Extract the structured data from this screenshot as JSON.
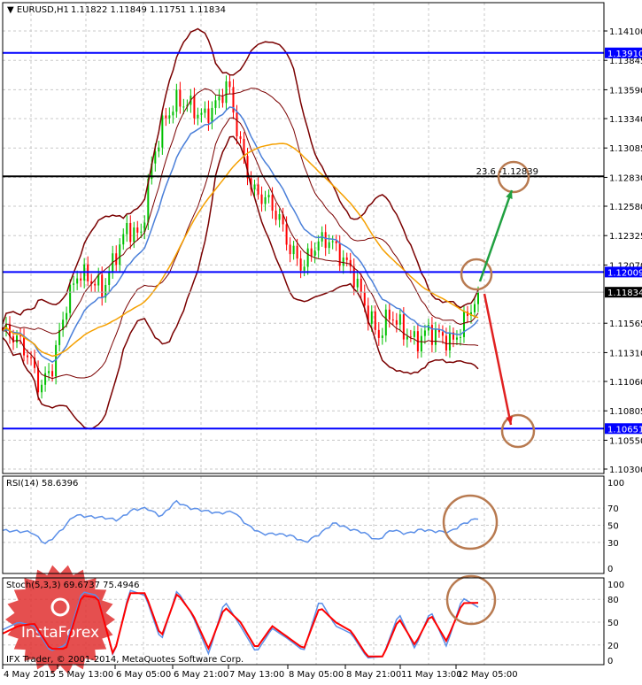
{
  "header": {
    "symbol_label": "EURUSD,H1",
    "ohlc": "1.11822 1.11849 1.11751 1.11834"
  },
  "colors": {
    "up": "#00c000",
    "down": "#ff0000",
    "ma_fast": "#4a7fd9",
    "ma_slow": "#f5a000",
    "bands": "#7a0000",
    "level_line": "#0000ff",
    "fib_line": "#000000",
    "annotation": "#b87a50",
    "arrow_up": "#20a040",
    "arrow_down": "#e02020",
    "rsi": "#5b8fe8",
    "stoch_main": "#5b8fe8",
    "stoch_signal": "#ff0000"
  },
  "watermark": {
    "logo_text": "InstaForex",
    "copyright": "IFX Trader, © 2001-2014, MetaQuotes Software Corp."
  },
  "chart_data": [
    {
      "type": "candlestick",
      "title": "EURUSD,H1",
      "ylim": [
        1.103,
        1.141
      ],
      "price_ticks": [
        "1.14100",
        "1.13845",
        "1.13590",
        "1.13340",
        "1.13085",
        "1.12830",
        "1.12580",
        "1.12325",
        "1.12070",
        "1.11565",
        "1.11310",
        "1.11060",
        "1.10805",
        "1.10550",
        "1.10300"
      ],
      "time_ticks": [
        "4 May 2015",
        "5 May 13:00",
        "6 May 05:00",
        "6 May 21:00",
        "7 May 13:00",
        "8 May 05:00",
        "8 May 21:00",
        "11 May 13:00",
        "12 May 05:00"
      ],
      "close_approx_every_4h": [
        1.115,
        1.1145,
        1.113,
        1.11,
        1.112,
        1.117,
        1.12,
        1.1195,
        1.1185,
        1.1215,
        1.124,
        1.123,
        1.13,
        1.1335,
        1.135,
        1.1345,
        1.1335,
        1.1345,
        1.1365,
        1.131,
        1.127,
        1.1265,
        1.125,
        1.122,
        1.1205,
        1.1225,
        1.123,
        1.1215,
        1.12,
        1.117,
        1.1145,
        1.1165,
        1.115,
        1.114,
        1.115,
        1.1145,
        1.114,
        1.116,
        1.1183
      ],
      "levels": [
        {
          "price": "1.13910",
          "kind": "support-resistance"
        },
        {
          "price": "1.12009",
          "kind": "support-resistance"
        },
        {
          "price": "1.10651",
          "kind": "support-resistance"
        },
        {
          "price": "1.11834",
          "kind": "current"
        }
      ],
      "fib_label": "23.6 -1.12839",
      "fib_price": 1.12839
    },
    {
      "type": "line",
      "title": "RSI(14) 58.6396",
      "ylim": [
        0,
        100
      ],
      "ticks": [
        "100",
        "70",
        "50",
        "30",
        "0"
      ],
      "values_approx": [
        44,
        43,
        42,
        28,
        43,
        62,
        60,
        59,
        56,
        68,
        70,
        60,
        78,
        70,
        67,
        64,
        66,
        50,
        40,
        40,
        38,
        30,
        40,
        53,
        46,
        42,
        32,
        45,
        40,
        45,
        43,
        42,
        52,
        58.6
      ]
    },
    {
      "type": "line",
      "title": "Stoch(5,3,3) 69.6737 75.4946",
      "ylim": [
        0,
        100
      ],
      "ticks": [
        "100",
        "80",
        "50",
        "20",
        "0"
      ],
      "series": [
        {
          "name": "main",
          "values_approx": [
            40,
            50,
            45,
            12,
            20,
            90,
            85,
            3,
            92,
            85,
            25,
            92,
            58,
            8,
            78,
            45,
            10,
            42,
            28,
            12,
            80,
            45,
            35,
            3,
            5,
            62,
            15,
            65,
            18,
            82,
            69.7
          ]
        },
        {
          "name": "signal",
          "values_approx": [
            35,
            45,
            48,
            15,
            15,
            85,
            82,
            5,
            88,
            88,
            30,
            88,
            60,
            15,
            70,
            50,
            15,
            45,
            30,
            15,
            70,
            50,
            38,
            5,
            5,
            55,
            20,
            60,
            25,
            75,
            75.5
          ]
        }
      ]
    }
  ]
}
